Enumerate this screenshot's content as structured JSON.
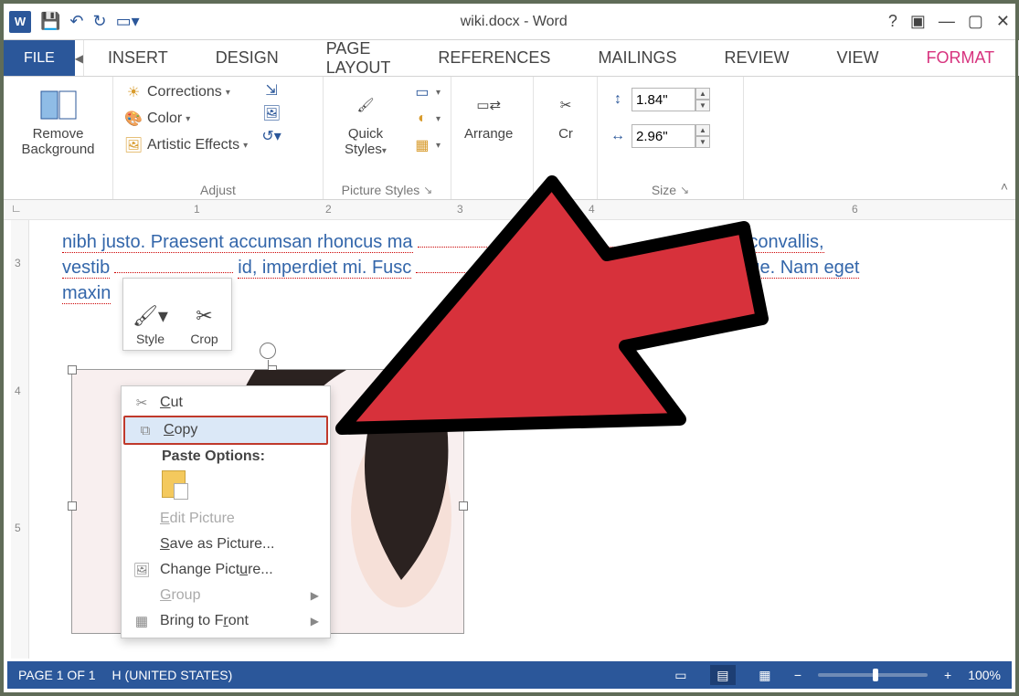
{
  "titlebar": {
    "title": "wiki.docx - Word"
  },
  "tabs": {
    "file": "FILE",
    "insert": "INSERT",
    "design": "DESIGN",
    "pagelayout": "PAGE LAYOUT",
    "references": "REFERENCES",
    "mailings": "MAILINGS",
    "review": "REVIEW",
    "view": "VIEW",
    "format": "FORMAT"
  },
  "ribbon": {
    "remove_bg": "Remove Background",
    "corrections": "Corrections",
    "color": "Color",
    "artistic": "Artistic Effects",
    "adjust_label": "Adjust",
    "quick_styles": "Quick Styles",
    "picture_styles_label": "Picture Styles",
    "arrange": "Arrange",
    "crop": "Cr",
    "size_label": "Size",
    "height": "1.84\"",
    "width": "2.96\""
  },
  "ruler": {
    "t1": "1",
    "t2": "2",
    "t3": "3",
    "t4": "4",
    "t6": "6",
    "v3": "3",
    "v4": "4",
    "v5": "5"
  },
  "body": {
    "line1a": "nibh justo. Praesent accumsan rhoncus ma",
    "line1b": "nim convallis,",
    "line2a": "vestib",
    "line2b": "id, imperdiet mi. Fusc",
    "line2c": "ellentesque. Nam eget",
    "line3": "maxin"
  },
  "mini": {
    "style": "Style",
    "crop": "Crop"
  },
  "ctx": {
    "cut": "Cut",
    "copy": "Copy",
    "paste_label": "Paste Options:",
    "edit": "Edit Picture",
    "saveas": "Save as Picture...",
    "change": "Change Picture...",
    "group": "Group",
    "bring": "Bring to Front"
  },
  "status": {
    "page": "PAGE 1 OF 1",
    "lang": "H (UNITED STATES)",
    "zoom": "100%"
  }
}
